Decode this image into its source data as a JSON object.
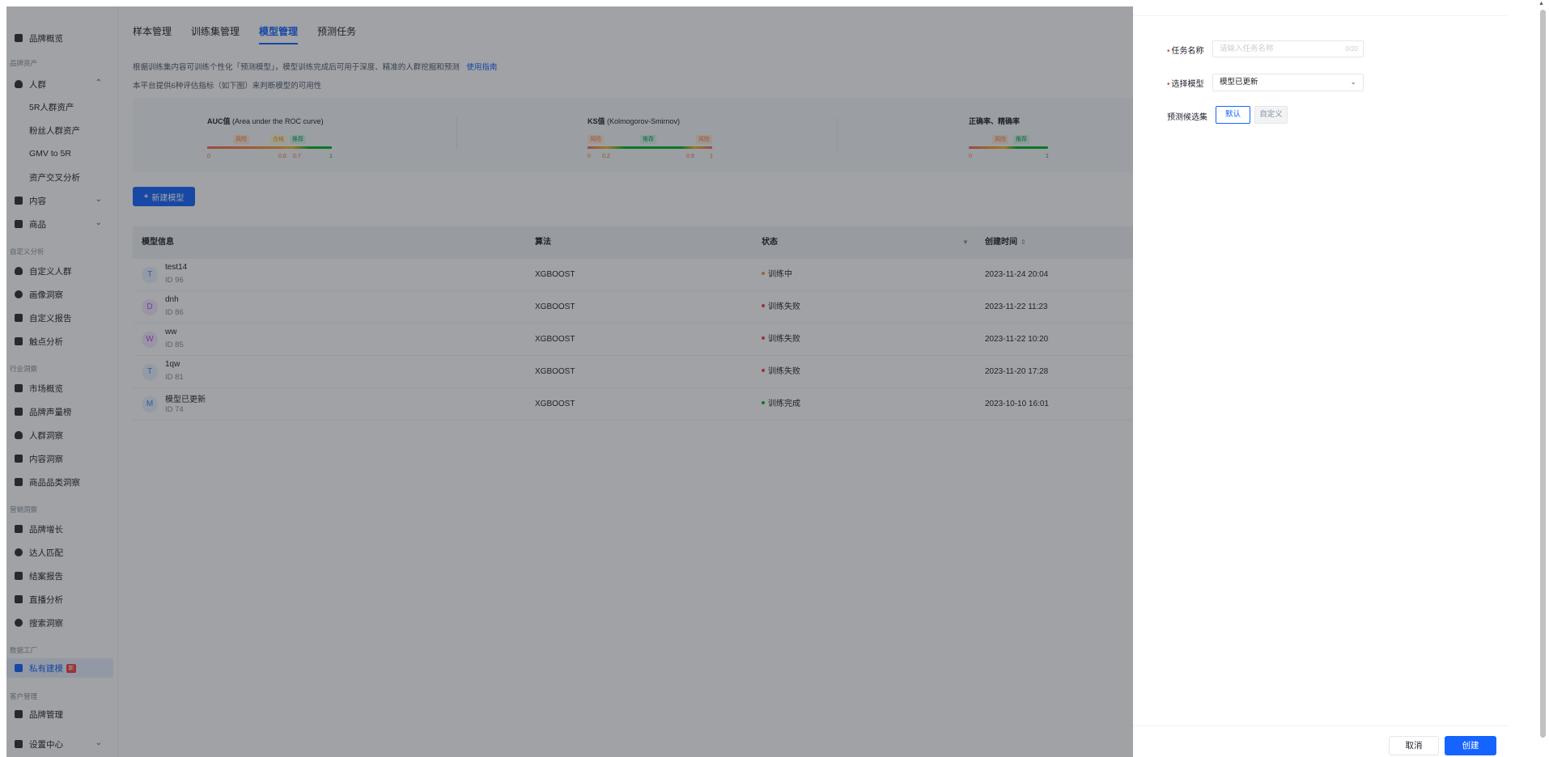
{
  "sidebar": {
    "top_item": "品牌概览",
    "groups": {
      "brand_assets": "品牌资产",
      "custom_analysis": "自定义分析",
      "industry": "行业洞察",
      "marketing": "营销洞察",
      "data_factory": "数据工厂",
      "customer_mgmt": "客户管理"
    },
    "crowd": "人群",
    "crowd_subs": [
      "5R人群资产",
      "粉丝人群资产",
      "GMV to 5R",
      "资产交叉分析"
    ],
    "content": "内容",
    "goods": "商品",
    "custom_crowd": "自定义人群",
    "portrait": "画像洞察",
    "custom_report": "自定义报告",
    "touchpoint": "触点分析",
    "market": "市场概览",
    "brand_volume": "品牌声量榜",
    "crowd_insight": "人群洞察",
    "content_insight": "内容洞察",
    "category_insight": "商品品类洞察",
    "brand_growth": "品牌增长",
    "talent_match": "达人匹配",
    "case_report": "结案报告",
    "live_analysis": "直播分析",
    "search_insight": "搜索洞察",
    "private_model": "私有建模",
    "new_badge": "新",
    "brand_mgmt": "品牌管理",
    "settings": "设置中心"
  },
  "main": {
    "tabs": [
      "样本管理",
      "训练集管理",
      "模型管理",
      "预测任务"
    ],
    "desc1": "根据训练集内容可训练个性化「预测模型」，模型训练完成后可用于深度、精准的人群挖掘和预测",
    "guide_link": "使用指南",
    "desc2": "本平台提供6种评估指标（如下图）来判断模型的可用性",
    "metrics": {
      "auc_title": "AUC值",
      "auc_sub": "(Area under the ROC curve)",
      "auc_tags": [
        "风险",
        "合格",
        "推荐"
      ],
      "auc_ticks": [
        "0",
        "0.6",
        "0.7",
        "1"
      ],
      "ks_title": "KS值",
      "ks_sub": "(Kolmogorov-Smirnov)",
      "ks_tags": [
        "风险",
        "推荐",
        "风险"
      ],
      "ks_ticks": [
        "0",
        "0.2",
        "0.9",
        "1"
      ],
      "acc_title": "正确率、精确率",
      "acc_tags": [
        "风险",
        "推荐"
      ],
      "acc_ticks": [
        "0",
        "1"
      ]
    },
    "new_model_button": "新建模型",
    "table": {
      "headers": [
        "模型信息",
        "算法",
        "状态",
        "创建时间"
      ],
      "rows": [
        {
          "avatar": "T",
          "name": "test14",
          "id": "ID 96",
          "algo": "XGBOOST",
          "status": "训练中",
          "status_color": "#ff9a2e",
          "time": "2023-11-24 20:04"
        },
        {
          "avatar": "D",
          "name": "dnh",
          "id": "ID 86",
          "algo": "XGBOOST",
          "status": "训练失败",
          "status_color": "#f53f3f",
          "time": "2023-11-22 11:23"
        },
        {
          "avatar": "W",
          "name": "ww",
          "id": "ID 85",
          "algo": "XGBOOST",
          "status": "训练失败",
          "status_color": "#f53f3f",
          "time": "2023-11-22 10:20"
        },
        {
          "avatar": "T",
          "name": "1qw",
          "id": "ID 81",
          "algo": "XGBOOST",
          "status": "训练失败",
          "status_color": "#f53f3f",
          "time": "2023-11-20 17:28"
        },
        {
          "avatar": "M",
          "name": "模型已更新",
          "id": "ID 74",
          "algo": "XGBOOST",
          "status": "训练完成",
          "status_color": "#00b42a",
          "time": "2023-10-10 16:01"
        }
      ]
    }
  },
  "drawer": {
    "task_name_label": "任务名称",
    "task_name_placeholder": "请输入任务名称",
    "task_name_count": "0/20",
    "model_label": "选择模型",
    "model_value": "模型已更新",
    "candidate_label": "预测候选集",
    "candidate_options": [
      "默认",
      "自定义"
    ],
    "cancel": "取消",
    "create": "创建"
  },
  "colors": {
    "accent": "#1664ff",
    "danger": "#f53f3f",
    "success": "#00b42a",
    "warning": "#ff9a2e"
  }
}
